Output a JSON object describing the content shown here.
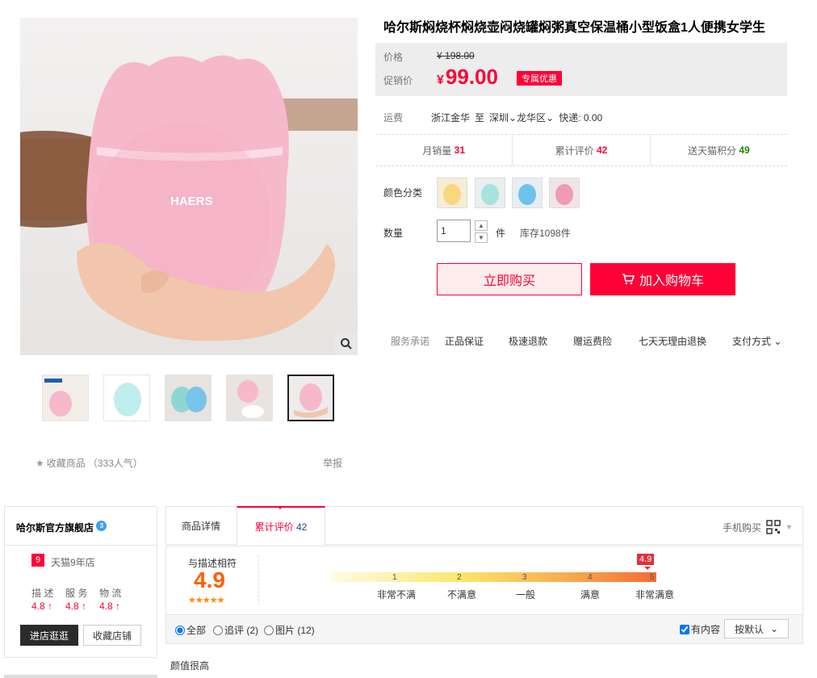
{
  "product": {
    "title": "哈尔斯焖烧杯焖烧壶闷烧罐焖粥真空保温桶小型饭盒1人便携女学生",
    "brand_on_cup": "HAERS"
  },
  "price": {
    "price_label": "价格",
    "old_currency": "¥",
    "old_value": "198.00",
    "promo_label": "促销价",
    "promo_currency": "¥",
    "promo_value": "99.00",
    "promo_tag": "专属优惠"
  },
  "shipping": {
    "label": "运费",
    "from": "浙江金华",
    "to_word": "至",
    "city": "深圳",
    "district": "龙华区",
    "fee": "快递: 0.00"
  },
  "stats": {
    "monthly_sales_label": "月销量",
    "monthly_sales": "31",
    "reviews_label": "累计评价",
    "reviews": "42",
    "points_label": "送天猫积分",
    "points": "49"
  },
  "options": {
    "color_label": "颜色分类",
    "quantity_label": "数量",
    "quantity_value": "1",
    "unit": "件",
    "stock": "库存1098件"
  },
  "actions": {
    "buy_now": "立即购买",
    "add_to_cart": "加入购物车"
  },
  "service": {
    "label": "服务承诺",
    "items": [
      "正品保证",
      "极速退款",
      "赠运费险",
      "七天无理由退换"
    ],
    "payment": "支付方式"
  },
  "gallery": {
    "favorite": "收藏商品",
    "popularity": "（333人气）",
    "report": "举报"
  },
  "shop": {
    "name": "哈尔斯官方旗舰店",
    "level": "9",
    "years": "天猫9年店",
    "ratings": [
      {
        "label": "描 述",
        "value": "4.8"
      },
      {
        "label": "服 务",
        "value": "4.8"
      },
      {
        "label": "物 流",
        "value": "4.8"
      }
    ],
    "enter_shop": "进店逛逛",
    "favorite_shop": "收藏店铺"
  },
  "tabs": {
    "details": "商品详情",
    "reviews_label": "累计评价",
    "reviews_count": "42",
    "mobile": "手机购买"
  },
  "review_summary": {
    "match_label": "与描述相符",
    "score": "4.9",
    "stars": "★★★★★",
    "marker": "4.9",
    "scale": [
      {
        "num": "1",
        "label": "非常不满"
      },
      {
        "num": "2",
        "label": "不满意"
      },
      {
        "num": "3",
        "label": "一般"
      },
      {
        "num": "4",
        "label": "满意"
      },
      {
        "num": "5",
        "label": "非常满意"
      }
    ]
  },
  "filters": {
    "all": "全部",
    "append": "追评 (2)",
    "pictures": "图片 (12)",
    "has_content": "有内容",
    "sort": "按默认"
  },
  "first_review": {
    "text": "颜值很高"
  },
  "colors": {
    "accent": "#ff0036",
    "cup_pink": "#f6b9cc"
  }
}
